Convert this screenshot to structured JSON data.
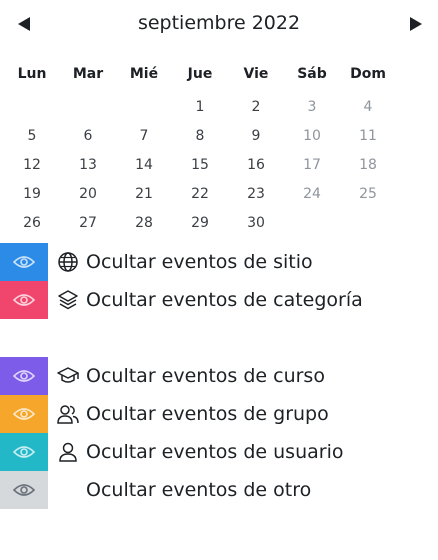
{
  "calendar": {
    "title": "septiembre 2022",
    "prev_label": "",
    "next_label": "",
    "weekdays": [
      "Lun",
      "Mar",
      "Mié",
      "Jue",
      "Vie",
      "Sáb",
      "Dom"
    ],
    "weeks": [
      [
        "",
        "",
        "",
        "1",
        "2",
        "3",
        "4"
      ],
      [
        "5",
        "6",
        "7",
        "8",
        "9",
        "10",
        "11"
      ],
      [
        "12",
        "13",
        "14",
        "15",
        "16",
        "17",
        "18"
      ],
      [
        "19",
        "20",
        "21",
        "22",
        "23",
        "24",
        "25"
      ],
      [
        "26",
        "27",
        "28",
        "29",
        "30",
        "",
        ""
      ]
    ]
  },
  "legend": {
    "items": [
      {
        "label": "Ocultar eventos de sitio",
        "color": "#2b8be6",
        "icon": "globe-icon"
      },
      {
        "label": "Ocultar eventos de categoría",
        "color": "#f0456c",
        "icon": "layers-icon"
      },
      {
        "label": "Ocultar eventos de curso",
        "color": "#7c5ce8",
        "icon": "graduation-cap-icon"
      },
      {
        "label": "Ocultar eventos de grupo",
        "color": "#f5a62b",
        "icon": "group-icon"
      },
      {
        "label": "Ocultar eventos de usuario",
        "color": "#22b8c8",
        "icon": "user-icon"
      },
      {
        "label": "Ocultar eventos de otro",
        "color": "#d6d9dc",
        "icon": ""
      }
    ]
  }
}
